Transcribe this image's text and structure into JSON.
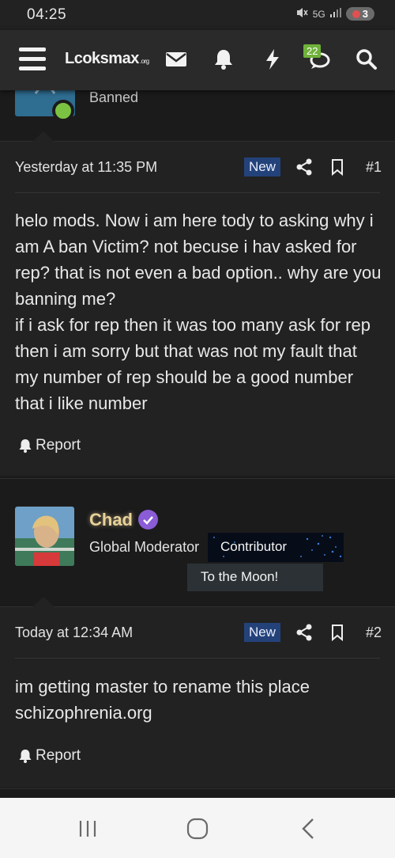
{
  "status": {
    "time": "04:25",
    "network": "5G",
    "battery": "3"
  },
  "nav": {
    "logo_main": "Lcoksmax",
    "logo_suffix": ".org",
    "alerts_badge": "22",
    "icons": [
      "menu-icon",
      "mail-icon",
      "bell-icon",
      "lightning-icon",
      "chat-icon",
      "search-icon"
    ]
  },
  "top_post": {
    "user_title": "Banned"
  },
  "post1": {
    "date": "Yesterday at 11:35 PM",
    "badge": "New",
    "number": "#1",
    "body": "helo mods. Now i am here tody to asking why i am A ban Victim? not becuse i hav asked for rep? that is not even a bad option.. why are you banning me?\nif i ask for rep then it was too many ask for rep then i am sorry but that was not my fault that my number of rep should be a good number that i like number",
    "report": "Report"
  },
  "post2_user": {
    "name": "Chad",
    "role": "Global Moderator",
    "banner1": "Contributor",
    "banner2": "To the Moon!"
  },
  "post2": {
    "date": "Today at 12:34 AM",
    "badge": "New",
    "number": "#2",
    "body": "im getting master to rename this place schizophrenia.org",
    "report": "Report"
  },
  "colors": {
    "background": "#1b1b1b",
    "panel": "#222222",
    "navbar": "#2a2a2a",
    "new_badge": "#24427a",
    "online": "#7cc242",
    "verified": "#8a5cd6",
    "username": "#e8d29a"
  }
}
